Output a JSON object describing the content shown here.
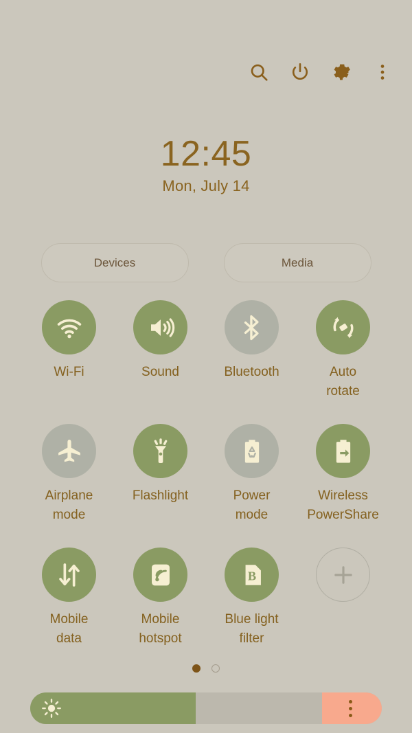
{
  "theme": {
    "background": "#cbc7bc",
    "accent_brown": "#84611f",
    "tile_on": "#8a9b63",
    "tile_off": "#afb1a6",
    "icon_cream": "#f6efd2",
    "slider_track": "#bcb8ad",
    "slider_right": "#f8a98d"
  },
  "topbar": {
    "icons": [
      {
        "name": "search-icon",
        "label": "Search"
      },
      {
        "name": "power-icon",
        "label": "Power"
      },
      {
        "name": "gear-icon",
        "label": "Settings"
      },
      {
        "name": "more-vertical-icon",
        "label": "More options"
      }
    ]
  },
  "clock": {
    "time": "12:45",
    "date": "Mon, July 14"
  },
  "shortcuts": {
    "devices_label": "Devices",
    "media_label": "Media"
  },
  "tiles": [
    {
      "label": "Wi-Fi",
      "icon": "wifi-icon",
      "state": "on"
    },
    {
      "label": "Sound",
      "icon": "sound-icon",
      "state": "on"
    },
    {
      "label": "Bluetooth",
      "icon": "bluetooth-icon",
      "state": "off"
    },
    {
      "label": "Auto\nrotate",
      "icon": "auto-rotate-icon",
      "state": "on"
    },
    {
      "label": "Airplane\nmode",
      "icon": "airplane-icon",
      "state": "off"
    },
    {
      "label": "Flashlight",
      "icon": "flashlight-icon",
      "state": "on"
    },
    {
      "label": "Power\nmode",
      "icon": "power-mode-icon",
      "state": "off"
    },
    {
      "label": "Wireless\nPowerShare",
      "icon": "wireless-powershare-icon",
      "state": "on"
    },
    {
      "label": "Mobile\ndata",
      "icon": "mobile-data-icon",
      "state": "on"
    },
    {
      "label": "Mobile\nhotspot",
      "icon": "mobile-hotspot-icon",
      "state": "on"
    },
    {
      "label": "Blue light\nfilter",
      "icon": "blue-light-filter-icon",
      "state": "on"
    },
    {
      "label": "",
      "icon": "add-icon",
      "state": "add"
    }
  ],
  "pagination": {
    "total": 2,
    "active_index": 0
  },
  "brightness": {
    "icon": "brightness-sun-icon",
    "value_percent": 47,
    "menu_icon": "more-vertical-icon"
  }
}
